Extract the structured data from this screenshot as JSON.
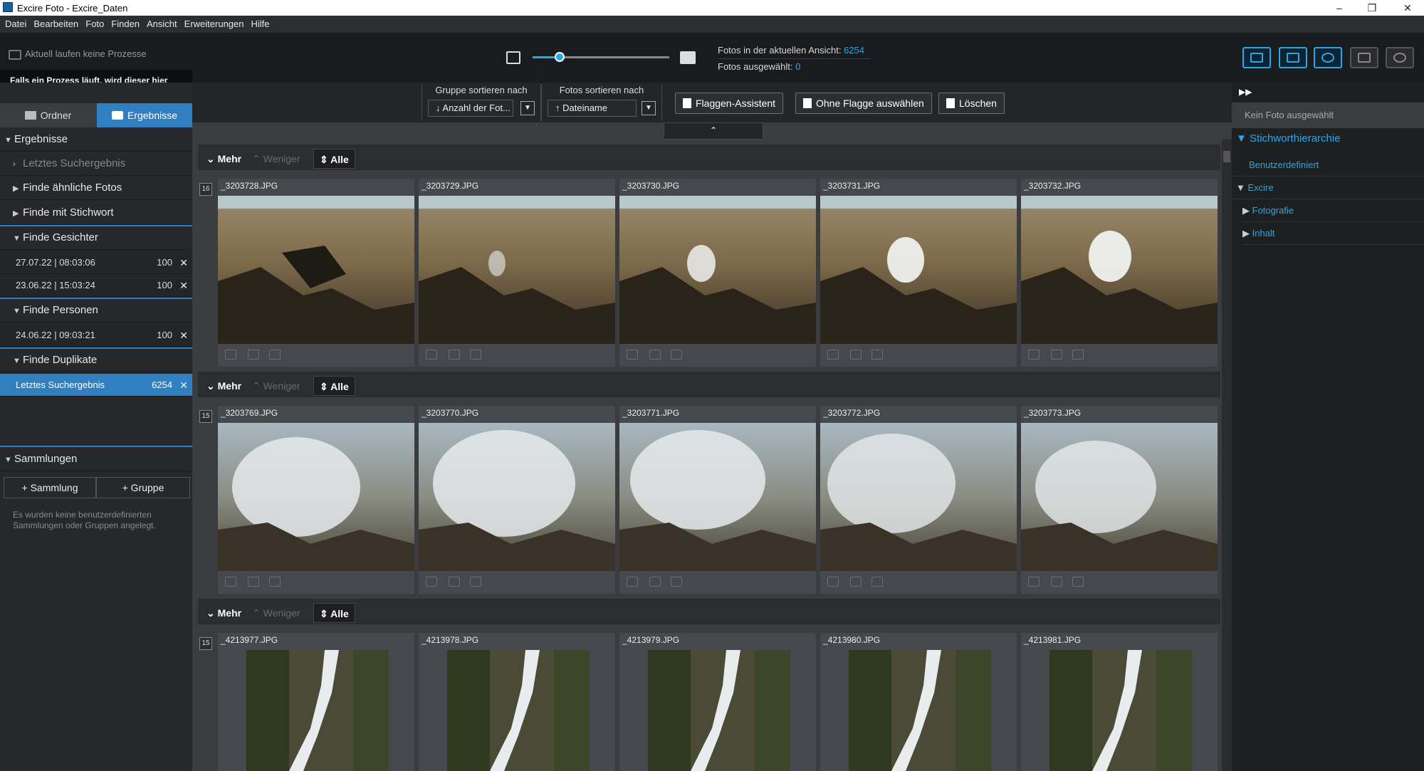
{
  "window": {
    "title": "Excire Foto - Excire_Daten",
    "controls": [
      "–",
      "❐",
      "✕"
    ]
  },
  "menu": [
    "Datei",
    "Bearbeiten",
    "Foto",
    "Finden",
    "Ansicht",
    "Erweiterungen",
    "Hilfe"
  ],
  "header": {
    "process_status": "Aktuell laufen keine Prozesse",
    "tooltip": "Falls ein Prozess läuft, wird dieser hier angezeigt.",
    "zoom_fraction": 0.2,
    "stats_label_view": "Fotos in der aktuellen Ansicht:",
    "stats_value_view": "6254",
    "stats_label_sel": "Fotos ausgewählt:",
    "stats_value_sel": "0",
    "tool_buttons": [
      "duplicates-icon",
      "key-icon",
      "face-icon",
      "people-icon",
      "search-icon"
    ]
  },
  "left": {
    "tabs": {
      "folder": "Ordner",
      "results": "Ergebnisse"
    },
    "results_header": "Ergebnisse",
    "last_result": "Letztes Suchergebnis",
    "similar": "Finde ähnliche Fotos",
    "keyword": "Finde mit Stichwort",
    "faces": "Finde Gesichter",
    "face_entries": [
      {
        "date": "27.07.22 | 08:03:06",
        "count": "100"
      },
      {
        "date": "23.06.22 | 15:03:24",
        "count": "100"
      }
    ],
    "persons": "Finde Personen",
    "person_entries": [
      {
        "date": "24.06.22 | 09:03:21",
        "count": "100"
      }
    ],
    "duplicates": "Finde Duplikate",
    "dup_entries": [
      {
        "date": "Letztes Suchergebnis",
        "count": "6254"
      }
    ],
    "collections": "Sammlungen",
    "btn_collection": "+ Sammlung",
    "btn_group": "+ Gruppe",
    "note": "Es wurden keine benutzerdefinierten Sammlungen oder Gruppen angelegt."
  },
  "toolbar": {
    "group_sort_label": "Gruppe sortieren nach",
    "group_sort_value": "Anzahl der Fot...",
    "photo_sort_label": "Fotos sortieren nach",
    "photo_sort_value": "Dateiname",
    "flag_assistant": "Flaggen-Assistent",
    "unflagged": "Ohne Flagge auswählen",
    "delete": "Löschen"
  },
  "groups": [
    {
      "more": "Mehr",
      "less": "Weniger",
      "all": "Alle",
      "count": "16",
      "files": [
        "_3203728.JPG",
        "_3203729.JPG",
        "_3203730.JPG",
        "_3203731.JPG",
        "_3203732.JPG"
      ]
    },
    {
      "more": "Mehr",
      "less": "Weniger",
      "all": "Alle",
      "count": "15",
      "files": [
        "_3203769.JPG",
        "_3203770.JPG",
        "_3203771.JPG",
        "_3203772.JPG",
        "_3203773.JPG"
      ]
    },
    {
      "more": "Mehr",
      "less": "Weniger",
      "all": "Alle",
      "count": "15",
      "files": [
        "_4213977.JPG",
        "_4213978.JPG",
        "_4213979.JPG",
        "_4213980.JPG",
        "_4213981.JPG"
      ]
    }
  ],
  "right": {
    "no_photo": "Kein Foto ausgewählt",
    "hierarchy": "Stichworthierarchie",
    "custom": "Benutzerdefiniert",
    "excire": "Excire",
    "photography": "Fotografie",
    "content": "Inhalt"
  },
  "colors": {
    "accent": "#2aa7e6",
    "selection": "#2f7fc1",
    "background": "#1e1f21"
  }
}
